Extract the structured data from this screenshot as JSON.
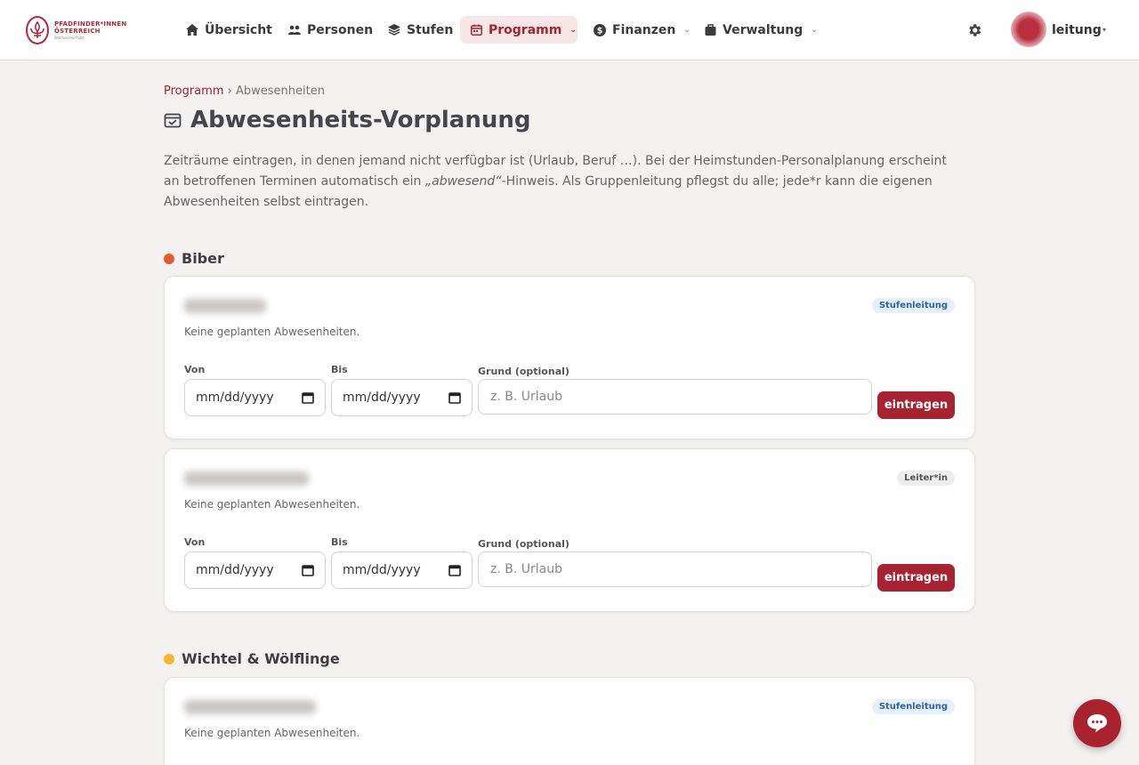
{
  "logo": {
    "line1": "PFADFINDER*INNEN",
    "line2": "ÖSTERREICH",
    "line3": "Waldviertel/Ybbs"
  },
  "nav": {
    "overview": "Übersicht",
    "persons": "Personen",
    "stages": "Stufen",
    "program": "Programm",
    "finances": "Finanzen",
    "administration": "Verwaltung"
  },
  "user": {
    "name": "leitung",
    "caret": "▾"
  },
  "breadcrumb": {
    "parent": "Programm",
    "separator": "›",
    "current": "Abwesenheiten"
  },
  "page": {
    "title": "Abwesenheits-Vorplanung",
    "intro_before": "Zeiträume eintragen, in denen jemand nicht verfügbar ist (Urlaub, Beruf …). Bei der Heimstunden-Personalplanung erscheint an betroffenen Terminen automatisch ein ",
    "intro_em": "„abwesend“",
    "intro_after": "-Hinweis. Als Gruppenleitung pflegst du alle; jede*r kann die eigenen Abwesenheiten selbst eintragen."
  },
  "groups": [
    {
      "name": "Biber",
      "color": "#e85a30",
      "people": [
        {
          "role": "Stufenleitung",
          "empty": "Keine geplanten Abwesenheiten.",
          "from_label": "Von",
          "to_label": "Bis",
          "reason_label": "Grund (optional)",
          "from_value": "mm/dd/yyyy",
          "to_value": "mm/dd/yyyy",
          "reason_placeholder": "z. B. Urlaub",
          "submit": "eintragen"
        },
        {
          "role": "Leiter*in",
          "empty": "Keine geplanten Abwesenheiten.",
          "from_label": "Von",
          "to_label": "Bis",
          "reason_label": "Grund (optional)",
          "from_value": "mm/dd/yyyy",
          "to_value": "mm/dd/yyyy",
          "reason_placeholder": "z. B. Urlaub",
          "submit": "eintragen"
        }
      ]
    },
    {
      "name": "Wichtel & Wölflinge",
      "color": "#f5b728",
      "people": [
        {
          "role": "Stufenleitung",
          "empty": "Keine geplanten Abwesenheiten."
        }
      ]
    }
  ],
  "colors": {
    "accent": "#a8232f",
    "badge_blue": "#2f64a8"
  }
}
